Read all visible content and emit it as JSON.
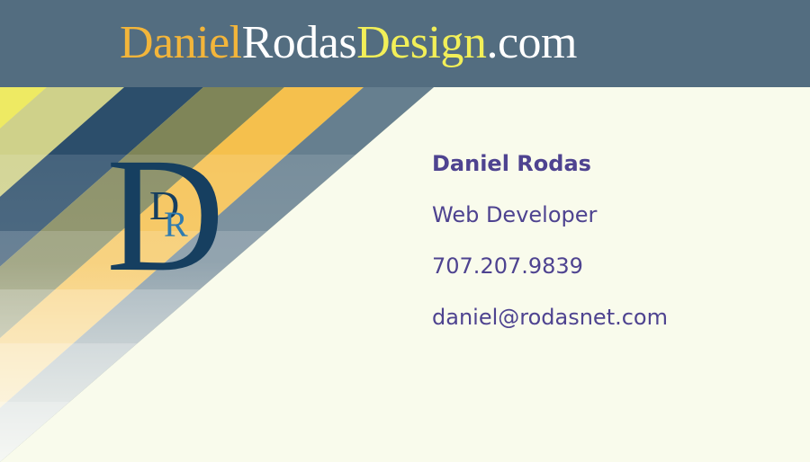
{
  "site_title": {
    "part1": "Daniel",
    "part2": "Rodas",
    "part3": "Design",
    "part4": ".com"
  },
  "colors": {
    "header_bg": "#536d80",
    "card_bg": "#f9fbec",
    "title_orange": "#f3b53a",
    "title_white": "#ffffff",
    "title_yellow": "#f2ef58",
    "contact_text": "#4e4390",
    "monogram_dark": "#163f60",
    "monogram_light": "#2f7bb0"
  },
  "monogram": {
    "big_letter": "D",
    "small_d": "D",
    "small_r": "R"
  },
  "contact": {
    "name": "Daniel Rodas",
    "title": "Web Developer",
    "phone": "707.207.9839",
    "email": "daniel@rodasnet.com"
  }
}
